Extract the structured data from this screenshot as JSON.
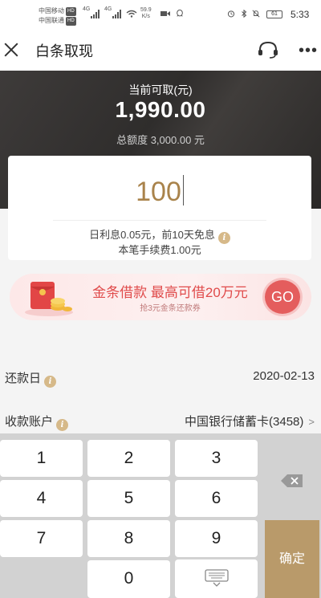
{
  "status_bar": {
    "carrier1": "中国移动",
    "carrier2": "中国联通",
    "hd": "HD",
    "net1": "4G",
    "net2": "4G",
    "speed_value": "59.9",
    "speed_unit": "K/s",
    "battery": "61",
    "time": "5:33"
  },
  "header": {
    "title": "白条取现",
    "close_icon": "close-icon",
    "service_icon": "headset-icon",
    "more_icon": "more-dots-icon",
    "more_label": "•••"
  },
  "hero": {
    "available_label": "当前可取(元)",
    "available_amount": "1,990.00",
    "total_label": "总额度 3,000.00 元"
  },
  "amount_card": {
    "amount_value": "100",
    "interest_text": "日利息0.05元，前10天免息",
    "fee_text": "本笔手续费1.00元"
  },
  "promo": {
    "title": "金条借款  最高可借20万元",
    "subtitle": "抢3元金条还款券",
    "go_label": "GO"
  },
  "repayment": {
    "label": "还款日",
    "date": "2020-02-13"
  },
  "account": {
    "label": "收款账户",
    "value": "中国银行储蓄卡(3458)",
    "chevron": ">"
  },
  "keypad": {
    "keys": [
      "1",
      "2",
      "3",
      "4",
      "5",
      "6",
      "7",
      "8",
      "9",
      "0"
    ],
    "confirm_label": "确定",
    "backspace_icon": "backspace-icon",
    "hide_icon": "keyboard-hide-icon"
  },
  "colors": {
    "gold": "#a9834b",
    "confirm_bg": "#b99a6a",
    "promo_red": "#e04b4b",
    "hero_bg": "#353231"
  }
}
